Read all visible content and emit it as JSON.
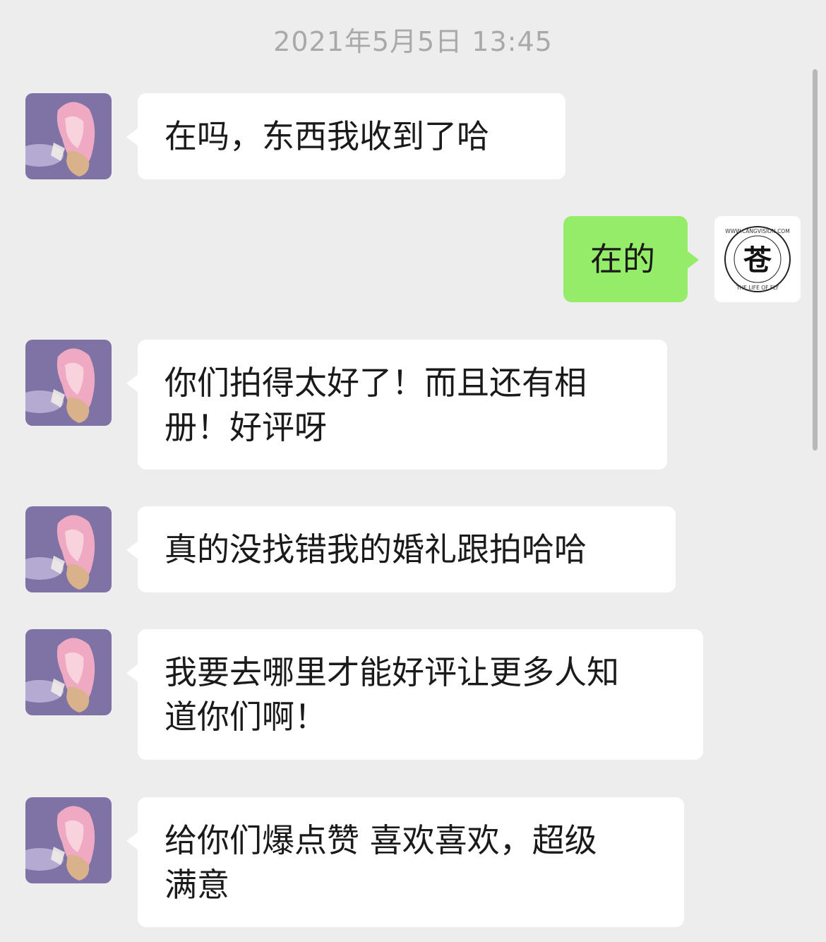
{
  "timestamp": "2021年5月5日 13:45",
  "contact": {
    "avatar_icon": "anime-girl-avatar-icon"
  },
  "me": {
    "avatar_icon": "cangvision-logo-icon",
    "logo_text_top": "WWW.CANGVISION.COM",
    "logo_text_bottom": "THE LIFE OF FLY",
    "logo_glyph": "苍"
  },
  "messages": [
    {
      "side": "left",
      "text": "在吗，东西我收到了哈"
    },
    {
      "side": "right",
      "text": "在的"
    },
    {
      "side": "left",
      "text": "你们拍得太好了！而且还有相\n册！好评呀"
    },
    {
      "side": "left",
      "text": "真的没找错我的婚礼跟拍哈哈"
    },
    {
      "side": "left",
      "text": "我要去哪里才能好评让更多人知\n道你们啊！"
    },
    {
      "side": "left",
      "text": "给你们爆点赞 喜欢喜欢，超级\n满意"
    }
  ],
  "colors": {
    "background": "#ededed",
    "bubble_self": "#95ec69",
    "bubble_other": "#ffffff",
    "timestamp_text": "#a9a9a9"
  }
}
